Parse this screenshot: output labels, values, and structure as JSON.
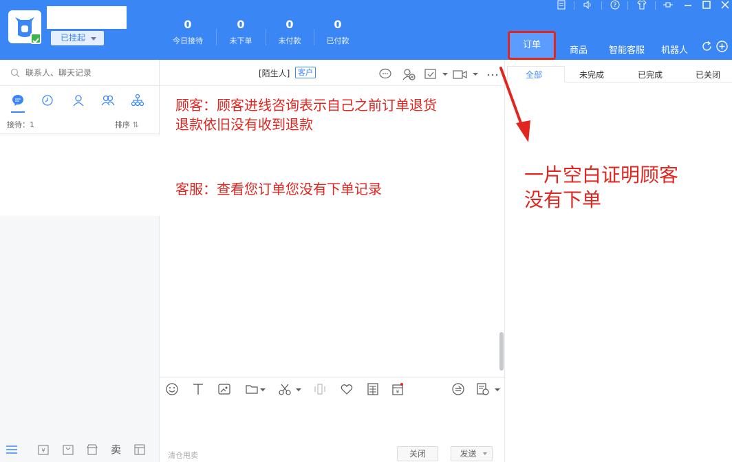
{
  "header": {
    "status": "已挂起",
    "stats": [
      {
        "value": "0",
        "label": "今日接待"
      },
      {
        "value": "0",
        "label": "未下单"
      },
      {
        "value": "0",
        "label": "未付款"
      },
      {
        "value": "0",
        "label": "已付款"
      }
    ],
    "tabs": {
      "orders": "订单",
      "products": "商品",
      "smart": "智能客服",
      "robot": "机器人"
    }
  },
  "left": {
    "search_placeholder": "联系人、聊天记录",
    "reception": "接待：1",
    "sort": "排序",
    "bottom_sell": "卖"
  },
  "chat": {
    "contact_name": "[陌生人]",
    "contact_tag": "客户",
    "messages": [
      {
        "line1": "顾客：顾客进线咨询表示自己之前订单退货",
        "line2": "退款依旧没有收到退款"
      },
      {
        "line1": "客服：查看您订单您没有下单记录"
      }
    ],
    "ad_text": "清仓甩卖",
    "close_btn": "关闭",
    "send_btn": "发送"
  },
  "orders": {
    "tabs": [
      "全部",
      "未完成",
      "已完成",
      "已关闭"
    ],
    "annotation_line1": "一片空白证明顾客",
    "annotation_line2": "没有下单"
  },
  "colors": {
    "primary": "#3b86f5",
    "annotation": "#e0261f",
    "online": "#3fb34f"
  }
}
